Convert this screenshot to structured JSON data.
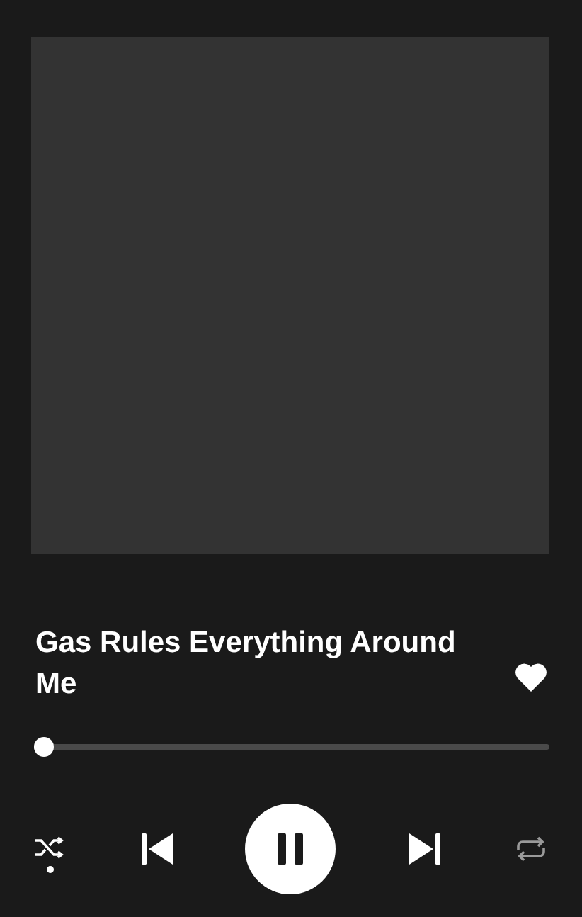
{
  "track": {
    "title": "Gas Rules Everything Around Me",
    "liked": true
  },
  "progress": {
    "level": 0.02
  },
  "controls": {
    "shuffle": true,
    "playing": true,
    "repeat": false
  }
}
